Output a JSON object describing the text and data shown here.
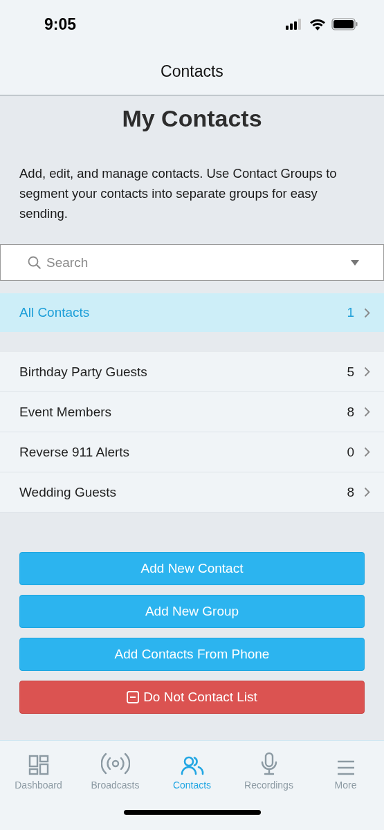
{
  "status_bar": {
    "time": "9:05"
  },
  "nav_bar": {
    "title": "Contacts"
  },
  "heading": "My Contacts",
  "description": "Add, edit, and manage contacts. Use Contact Groups to segment your contacts into separate groups for easy sending.",
  "search": {
    "placeholder": "Search"
  },
  "all_contacts": {
    "label": "All Contacts",
    "count": "1",
    "selected": true
  },
  "groups": [
    {
      "label": "Birthday Party Guests",
      "count": "5",
      "selected": false
    },
    {
      "label": "Event Members",
      "count": "8",
      "selected": false
    },
    {
      "label": "Reverse 911 Alerts",
      "count": "0",
      "selected": false
    },
    {
      "label": "Wedding Guests",
      "count": "8",
      "selected": false
    }
  ],
  "buttons": [
    {
      "label": "Add New Contact",
      "kind": "primary"
    },
    {
      "label": "Add New Group",
      "kind": "primary"
    },
    {
      "label": "Add Contacts From Phone",
      "kind": "primary"
    },
    {
      "label": "Do Not Contact List",
      "kind": "danger"
    }
  ],
  "tabs": [
    {
      "label": "Dashboard",
      "selected": false
    },
    {
      "label": "Broadcasts",
      "selected": false
    },
    {
      "label": "Contacts",
      "selected": true
    },
    {
      "label": "Recordings",
      "selected": false
    },
    {
      "label": "More",
      "selected": false
    }
  ]
}
